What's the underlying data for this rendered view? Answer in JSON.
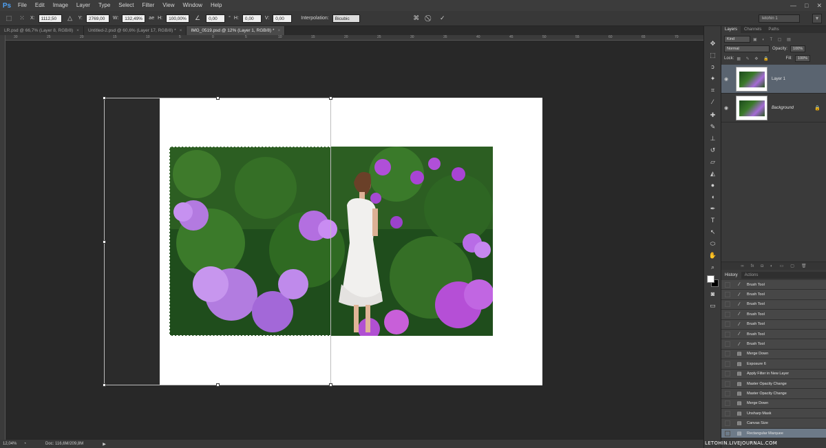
{
  "app": {
    "logo": "Ps"
  },
  "menu": [
    "File",
    "Edit",
    "Image",
    "Layer",
    "Type",
    "Select",
    "Filter",
    "View",
    "Window",
    "Help"
  ],
  "window_controls": {
    "minimize": "—",
    "maximize": "□",
    "close": "✕"
  },
  "options": {
    "x_label": "X:",
    "x_value": "1112,50 p",
    "y_label": "Y:",
    "y_value": "2769,00 p",
    "w_label": "W:",
    "w_value": "132,49%",
    "link": "ae",
    "h_label": "H:",
    "h_value": "100,00%",
    "angle_value": "0,00",
    "angle_unit": "°",
    "hskew_label": "H:",
    "hskew_value": "0,00",
    "vskew_label": "V:",
    "vskew_value": "0,00",
    "interp_label": "Interpolation:",
    "interp_value": "Bicubic",
    "workspace": "letohin 1"
  },
  "tabs": [
    {
      "label": "LR.psd @ 66,7% (Layer 8, RGB/8)",
      "close": "×"
    },
    {
      "label": "Untitled-2.psd @ 60,6% (Layer 17, RGB/8) *",
      "close": "×"
    },
    {
      "label": "IMG_0519.psd @ 12% (Layer 1, RGB/8) *",
      "close": "×"
    }
  ],
  "ruler_top": [
    "30",
    "25",
    "20",
    "15",
    "10",
    "5",
    "0",
    "5",
    "10",
    "15",
    "20",
    "25",
    "30",
    "35",
    "40",
    "45",
    "50",
    "55",
    "60",
    "65",
    "70"
  ],
  "status": {
    "zoom": "12,04%",
    "doc": "Doc: 116,6M/209,8M"
  },
  "panels": {
    "layers_tab": "Layers",
    "channels_tab": "Channels",
    "paths_tab": "Paths",
    "kind": "Kind",
    "blend_mode": "Normal",
    "opacity_label": "Opacity:",
    "opacity_value": "100%",
    "lock_label": "Lock:",
    "fill_label": "Fill:",
    "fill_value": "100%",
    "layers": [
      {
        "name": "Layer 1"
      },
      {
        "name": "Background"
      }
    ]
  },
  "history": {
    "history_tab": "History",
    "actions_tab": "Actions",
    "items": [
      "Brush Tool",
      "Brush Tool",
      "Brush Tool",
      "Brush Tool",
      "Brush Tool",
      "Brush Tool",
      "Brush Tool",
      "Merge Down",
      "Exposure 6",
      "Apply Filter in New Layer",
      "Master Opacity Change",
      "Master Opacity Change",
      "Merge Down",
      "Unsharp Mask",
      "Canvas Size",
      "Rectangular Marquee"
    ]
  },
  "watermark": "LETOHIN.LIVEJOURNAL.COM"
}
